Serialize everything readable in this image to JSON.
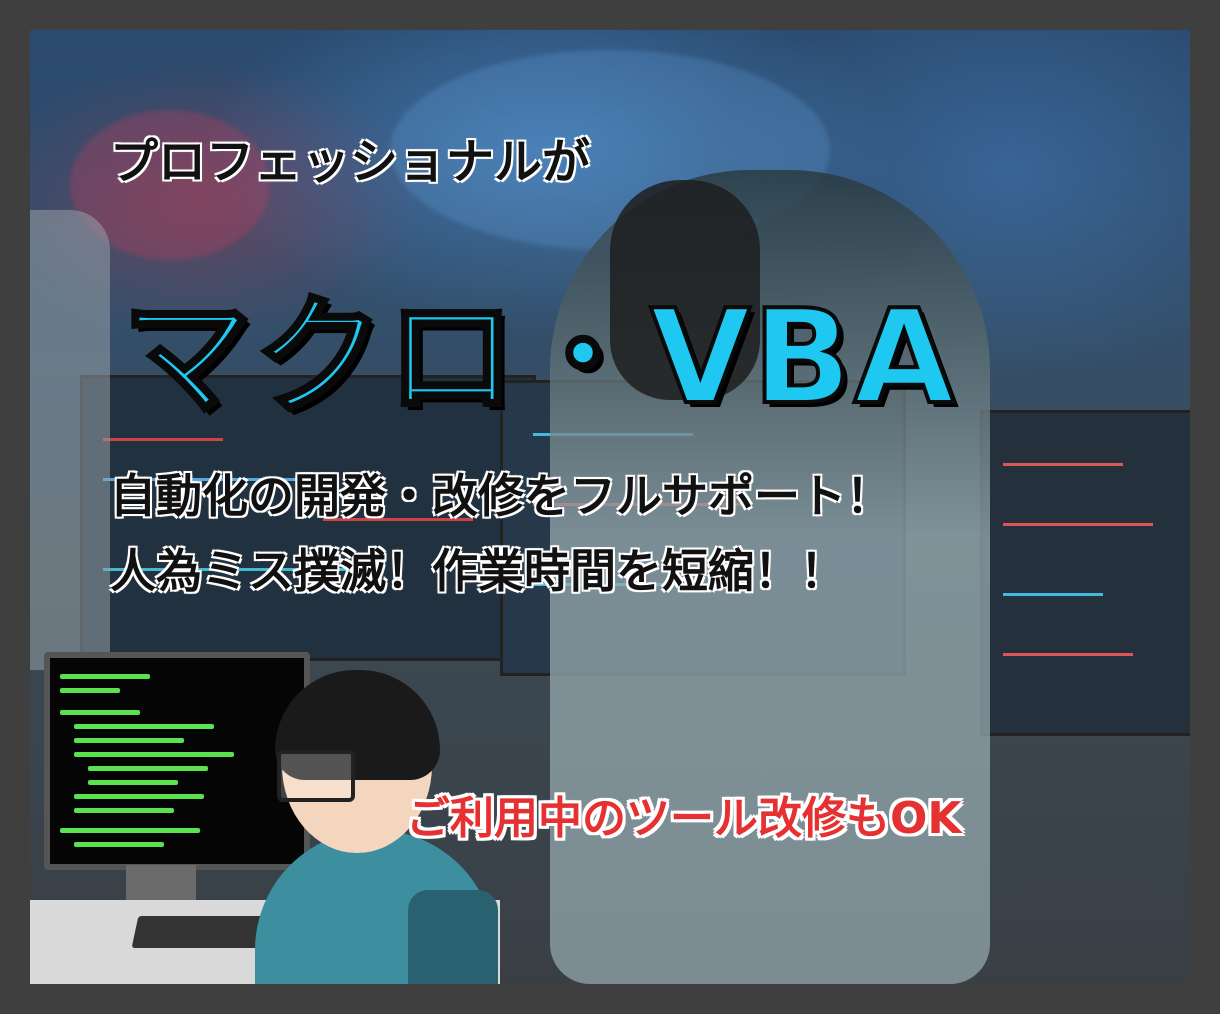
{
  "banner": {
    "line1": "プロフェッショナルが",
    "line2": "マクロ・VBA",
    "line3": "自動化の開発・改修をフルサポート！",
    "line4": "人為ミス撲滅！作業時間を短縮！！",
    "badge": "ご利用中のツール改修もOK"
  },
  "colors": {
    "frame": "#3f3f3f",
    "accent_cyan": "#1ec8f0",
    "badge_red": "#e53131",
    "code_green": "#5be24f"
  }
}
